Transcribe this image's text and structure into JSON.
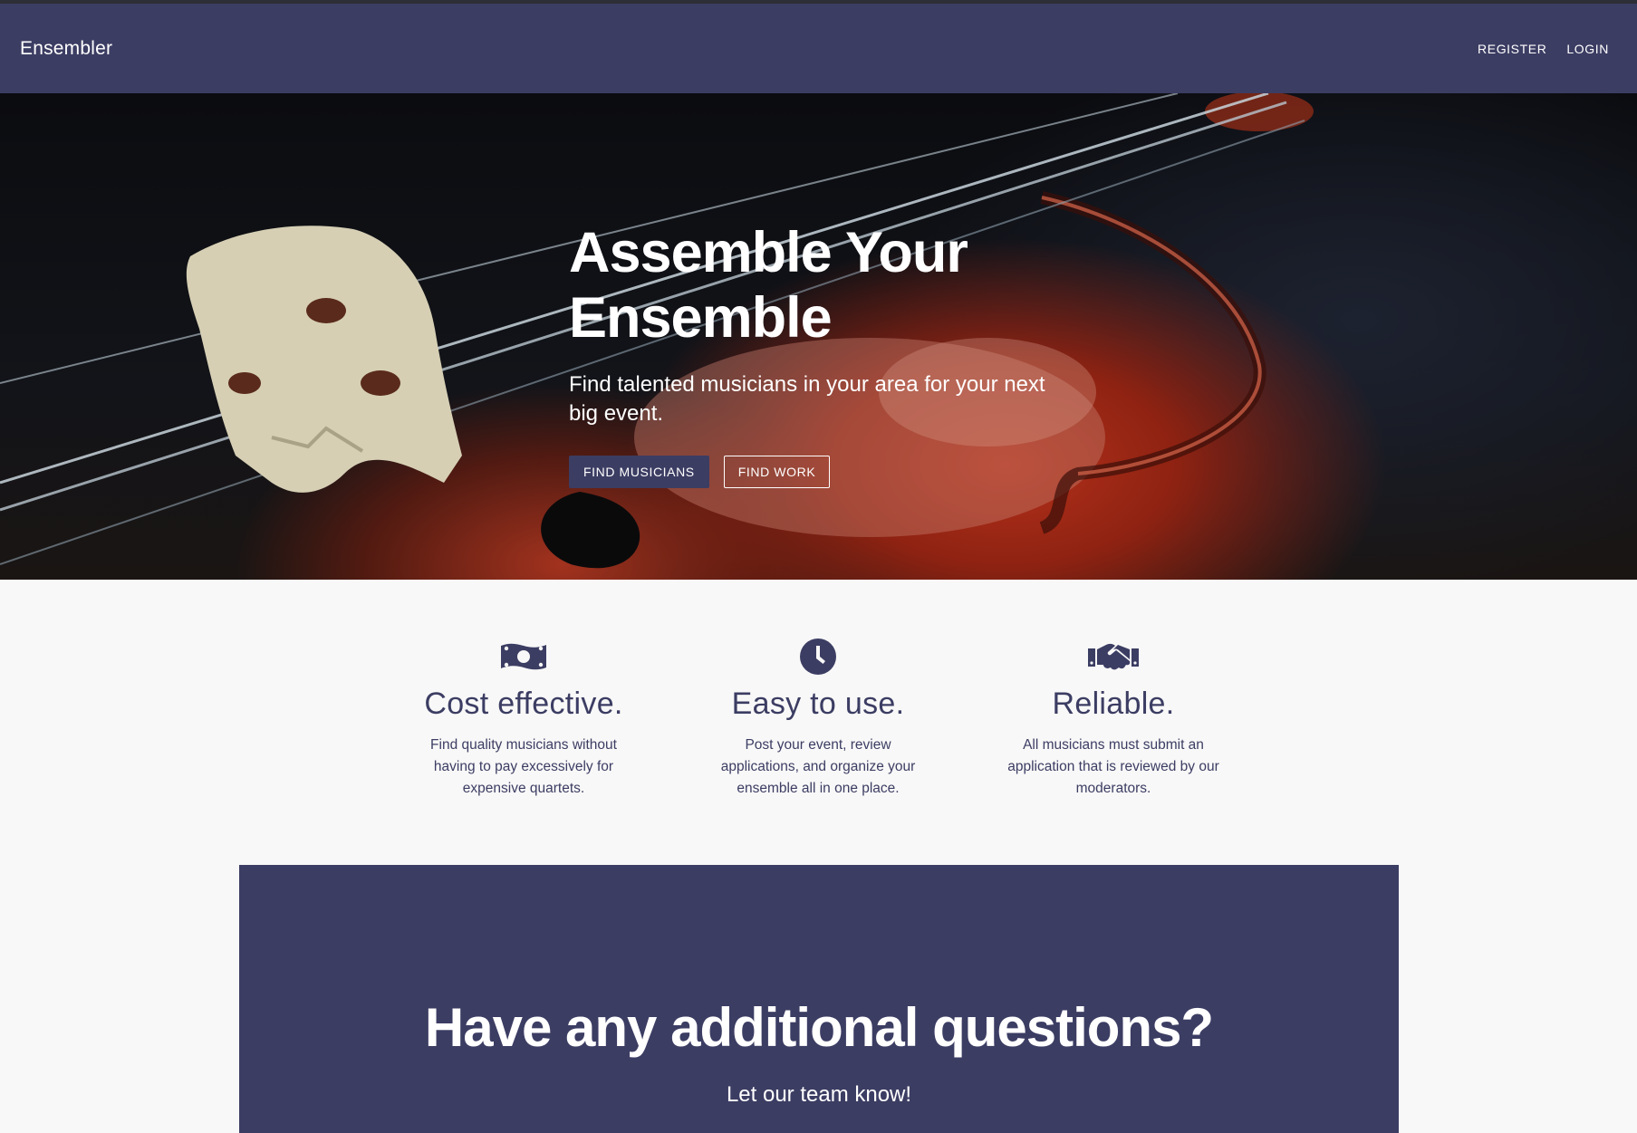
{
  "navbar": {
    "brand": "Ensembler",
    "links": [
      {
        "label": "REGISTER"
      },
      {
        "label": "LOGIN"
      }
    ]
  },
  "hero": {
    "title_line1": "Assemble Your",
    "title_line2": "Ensemble",
    "subtitle": "Find talented musicians in your area for your next big event.",
    "primary_button": "FIND MUSICIANS",
    "secondary_button": "FIND WORK"
  },
  "features": [
    {
      "icon": "money-bill-icon",
      "title": "Cost effective.",
      "text": "Find quality musicians without having to pay excessively for expensive quartets."
    },
    {
      "icon": "clock-icon",
      "title": "Easy to use.",
      "text": "Post your event, review applications, and organize your ensemble all in one place."
    },
    {
      "icon": "handshake-icon",
      "title": "Reliable.",
      "text": "All musicians must submit an application that is reviewed by our moderators."
    }
  ],
  "cta": {
    "title": "Have any additional questions?",
    "subtitle": "Let our team know!"
  },
  "colors": {
    "brand": "#3c3d63",
    "background": "#f8f8f8",
    "text_on_brand": "#ffffff"
  }
}
